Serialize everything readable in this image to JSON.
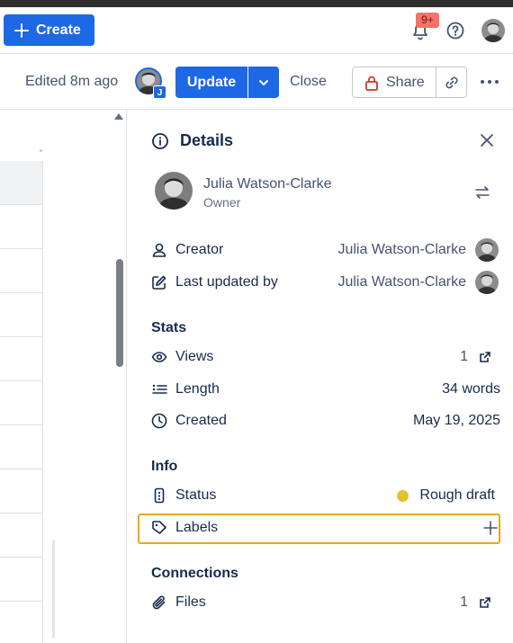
{
  "topbar": {
    "create_label": "Create",
    "notification_count": "9+"
  },
  "toolbar": {
    "edited_text": "Edited 8m ago",
    "collaborator_initial": "J",
    "update_label": "Update",
    "close_label": "Close",
    "share_label": "Share"
  },
  "details": {
    "title": "Details",
    "owner": {
      "name": "Julia Watson-Clarke",
      "role": "Owner"
    },
    "creator": {
      "label": "Creator",
      "value": "Julia Watson-Clarke"
    },
    "last_updated": {
      "label": "Last updated by",
      "value": "Julia Watson-Clarke"
    },
    "stats": {
      "heading": "Stats",
      "views": {
        "label": "Views",
        "value": "1"
      },
      "length": {
        "label": "Length",
        "value": "34 words"
      },
      "created": {
        "label": "Created",
        "value": "May 19, 2025"
      }
    },
    "info": {
      "heading": "Info",
      "status": {
        "label": "Status",
        "value": "Rough draft",
        "color": "#e2c32d"
      },
      "labels": {
        "label": "Labels"
      }
    },
    "connections": {
      "heading": "Connections",
      "files": {
        "label": "Files",
        "value": "1"
      }
    }
  },
  "colors": {
    "brand": "#1d68e5",
    "highlight": "#e8a820",
    "badge": "#f87168"
  }
}
